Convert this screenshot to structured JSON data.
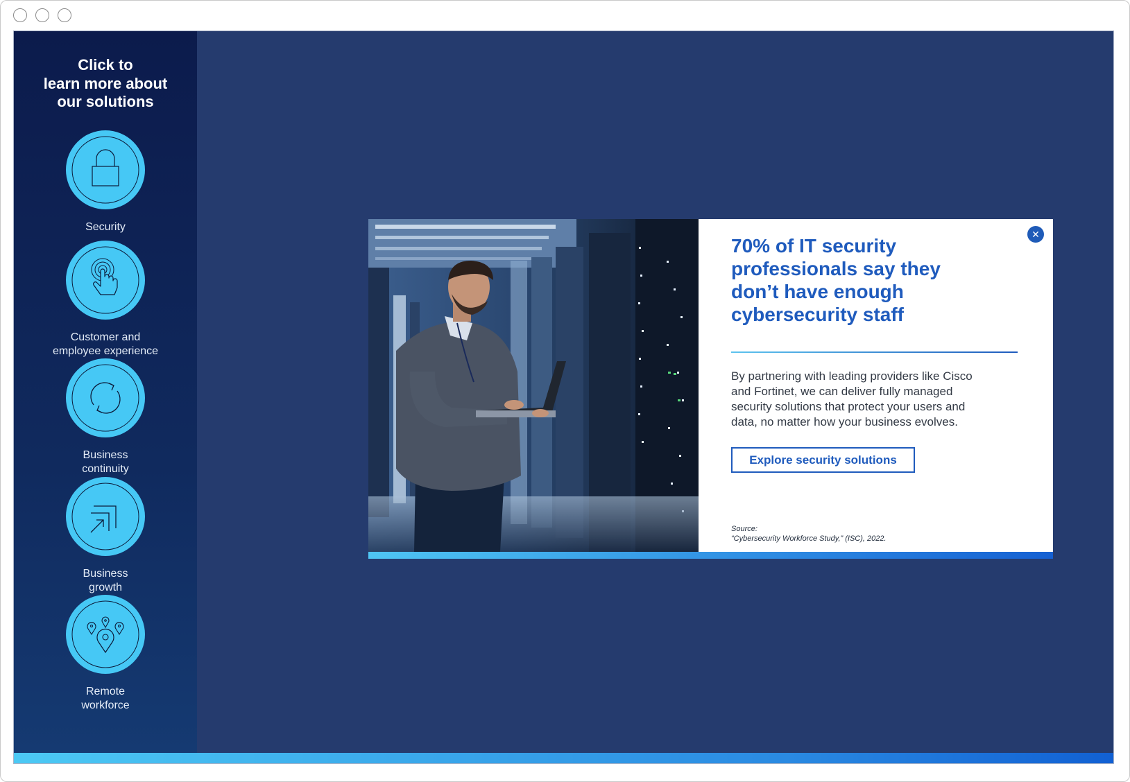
{
  "sidebar": {
    "title_lines": [
      "Click to",
      "learn more about",
      "our solutions"
    ],
    "items": [
      {
        "icon": "lock-icon",
        "label_lines": [
          "Security"
        ]
      },
      {
        "icon": "touch-hand-icon",
        "label_lines": [
          "Customer and",
          "employee experience"
        ]
      },
      {
        "icon": "refresh-cycle-icon",
        "label_lines": [
          "Business",
          "continuity"
        ]
      },
      {
        "icon": "growth-arrows-icon",
        "label_lines": [
          "Business",
          "growth"
        ]
      },
      {
        "icon": "location-pins-icon",
        "label_lines": [
          "Remote",
          "workforce"
        ]
      }
    ]
  },
  "modal": {
    "headline_lines": [
      "70% of IT security",
      "professionals say they",
      "don’t have enough",
      "cybersecurity staff"
    ],
    "body_lines": [
      "By partnering with leading providers like Cisco",
      "and Fortinet, we can deliver fully managed",
      "security solutions that protect your users and",
      "data, no matter how your business evolves."
    ],
    "cta_label": "Explore security solutions",
    "source_label": "Source:",
    "source_text": "“Cybersecurity Workforce Study,” (ISC), 2022.",
    "close_glyph": "✕"
  },
  "colors": {
    "stage_bg": "#253b6e",
    "accent_blue": "#1f5bbd",
    "icon_circle": "#46c8f5"
  }
}
